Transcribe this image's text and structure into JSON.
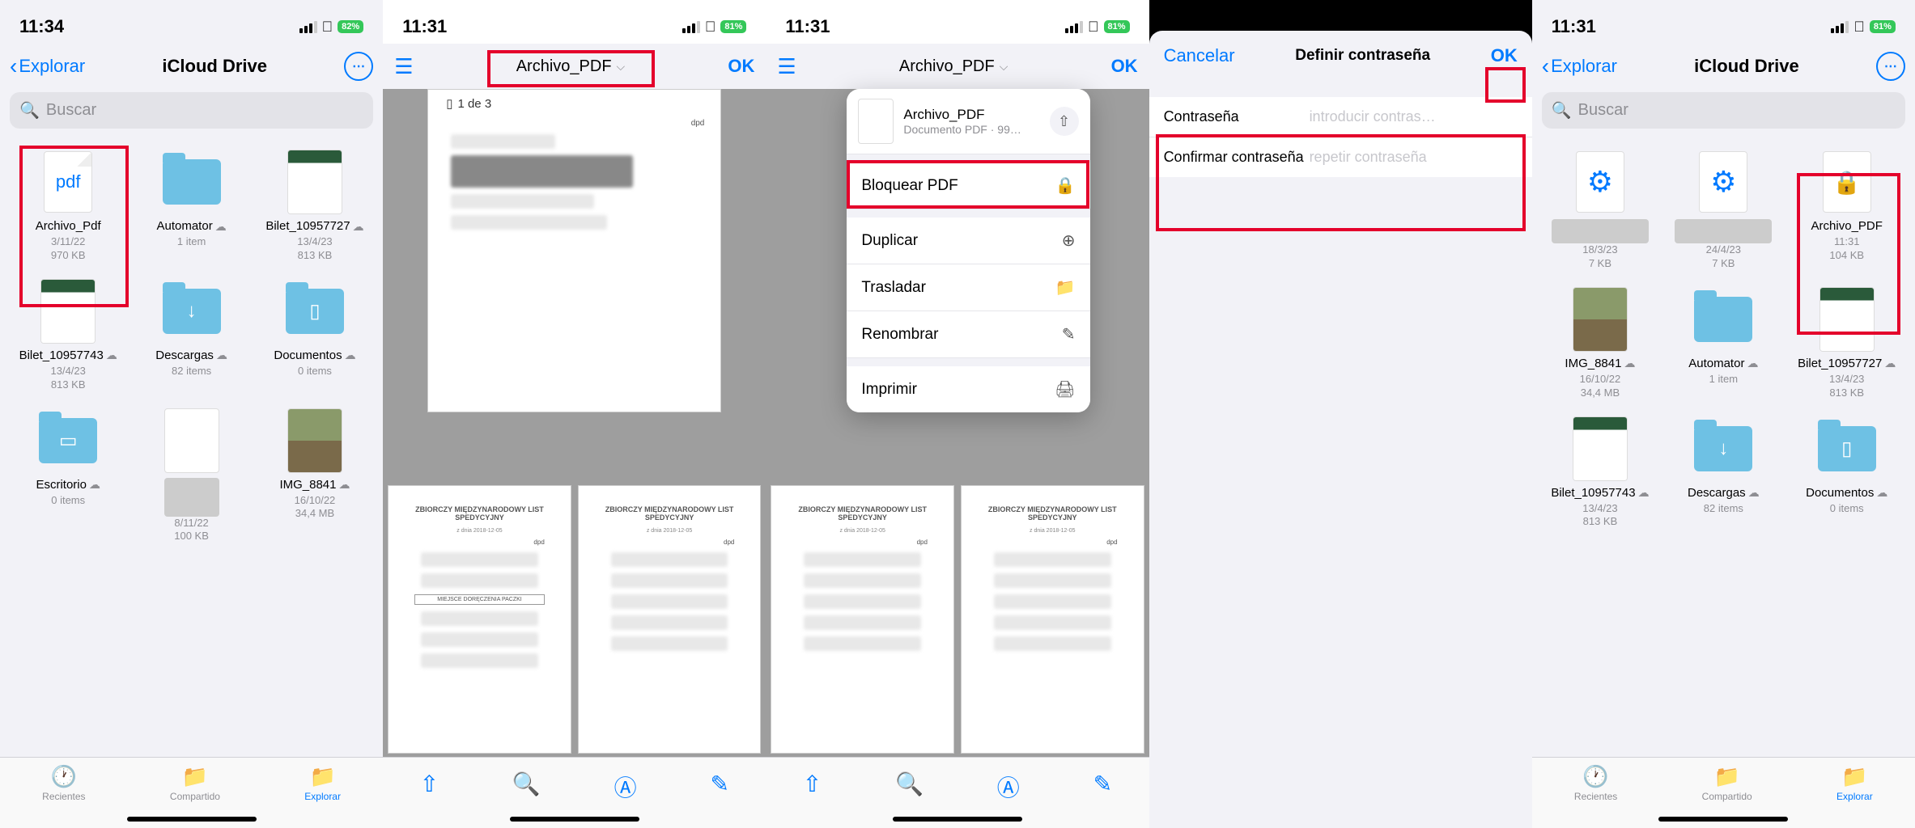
{
  "colors": {
    "accent": "#007aff",
    "red": "#e4002b",
    "green_battery": "#34c759"
  },
  "common": {
    "wifi": "􀙇",
    "signal": "••••"
  },
  "s1": {
    "time": "11:34",
    "battery": "82%",
    "back": "Explorar",
    "title": "iCloud Drive",
    "search": "Buscar",
    "files": [
      {
        "name": "Archivo_Pdf",
        "meta1": "3/11/22",
        "meta2": "970 KB",
        "type": "pdf"
      },
      {
        "name": "Automator",
        "meta1": "1 item",
        "meta2": "",
        "type": "folder",
        "cloud": true
      },
      {
        "name": "Bilet_10957727",
        "meta1": "13/4/23",
        "meta2": "813 KB",
        "type": "thumb",
        "cloud": true
      },
      {
        "name": "Bilet_10957743",
        "meta1": "13/4/23",
        "meta2": "813 KB",
        "type": "thumb",
        "cloud": true
      },
      {
        "name": "Descargas",
        "meta1": "82 items",
        "meta2": "",
        "type": "folder-dl",
        "cloud": true
      },
      {
        "name": "Documentos",
        "meta1": "0 items",
        "meta2": "",
        "type": "folder-doc",
        "cloud": true
      },
      {
        "name": "Escritorio",
        "meta1": "0 items",
        "meta2": "",
        "type": "folder-desk",
        "cloud": true
      },
      {
        "name": "",
        "meta1": "8/11/22",
        "meta2": "100 KB",
        "type": "gray"
      },
      {
        "name": "IMG_8841",
        "meta1": "16/10/22",
        "meta2": "34,4 MB",
        "type": "photo",
        "cloud": true
      }
    ],
    "tabs": {
      "recent": "Recientes",
      "shared": "Compartido",
      "browse": "Explorar"
    }
  },
  "s2": {
    "time": "11:31",
    "battery": "81%",
    "title": "Archivo_PDF",
    "ok": "OK",
    "counter": "1 de 3",
    "doc_header": "ZBIORCZY MIĘDZYNARODOWY LIST SPEDYCYJNY",
    "doc_sub": "z dnia 2018-12-05",
    "brand": "dpd",
    "section": "MIEJSCE DORĘCZENIA PACZKI"
  },
  "s3": {
    "time": "11:31",
    "battery": "81%",
    "title": "Archivo_PDF",
    "ok": "OK",
    "menu_title": "Archivo_PDF",
    "menu_sub": "Documento PDF · 99…",
    "items": {
      "lock": "Bloquear PDF",
      "dup": "Duplicar",
      "move": "Trasladar",
      "rename": "Renombrar",
      "print": "Imprimir"
    }
  },
  "s4": {
    "cancel": "Cancelar",
    "title": "Definir contraseña",
    "ok": "OK",
    "pass_label": "Contraseña",
    "pass_ph": "introducir contras…",
    "conf_label": "Confirmar contraseña",
    "conf_ph": "repetir contraseña"
  },
  "s5": {
    "time": "11:31",
    "battery": "81%",
    "back": "Explorar",
    "title": "iCloud Drive",
    "search": "Buscar",
    "files": [
      {
        "name": "",
        "meta1": "18/3/23",
        "meta2": "7 KB",
        "type": "gear"
      },
      {
        "name": "",
        "meta1": "24/4/23",
        "meta2": "7 KB",
        "type": "gear"
      },
      {
        "name": "Archivo_PDF",
        "meta1": "11:31",
        "meta2": "104 KB",
        "type": "lock"
      },
      {
        "name": "IMG_8841",
        "meta1": "16/10/22",
        "meta2": "34,4 MB",
        "type": "photo",
        "cloud": true
      },
      {
        "name": "Automator",
        "meta1": "1 item",
        "meta2": "",
        "type": "folder",
        "cloud": true
      },
      {
        "name": "Bilet_10957727",
        "meta1": "13/4/23",
        "meta2": "813 KB",
        "type": "thumb",
        "cloud": true
      },
      {
        "name": "Bilet_10957743",
        "meta1": "13/4/23",
        "meta2": "813 KB",
        "type": "thumb",
        "cloud": true
      },
      {
        "name": "Descargas",
        "meta1": "82 items",
        "meta2": "",
        "type": "folder-dl",
        "cloud": true
      },
      {
        "name": "Documentos",
        "meta1": "0 items",
        "meta2": "",
        "type": "folder-doc",
        "cloud": true
      }
    ],
    "tabs": {
      "recent": "Recientes",
      "shared": "Compartido",
      "browse": "Explorar"
    }
  }
}
